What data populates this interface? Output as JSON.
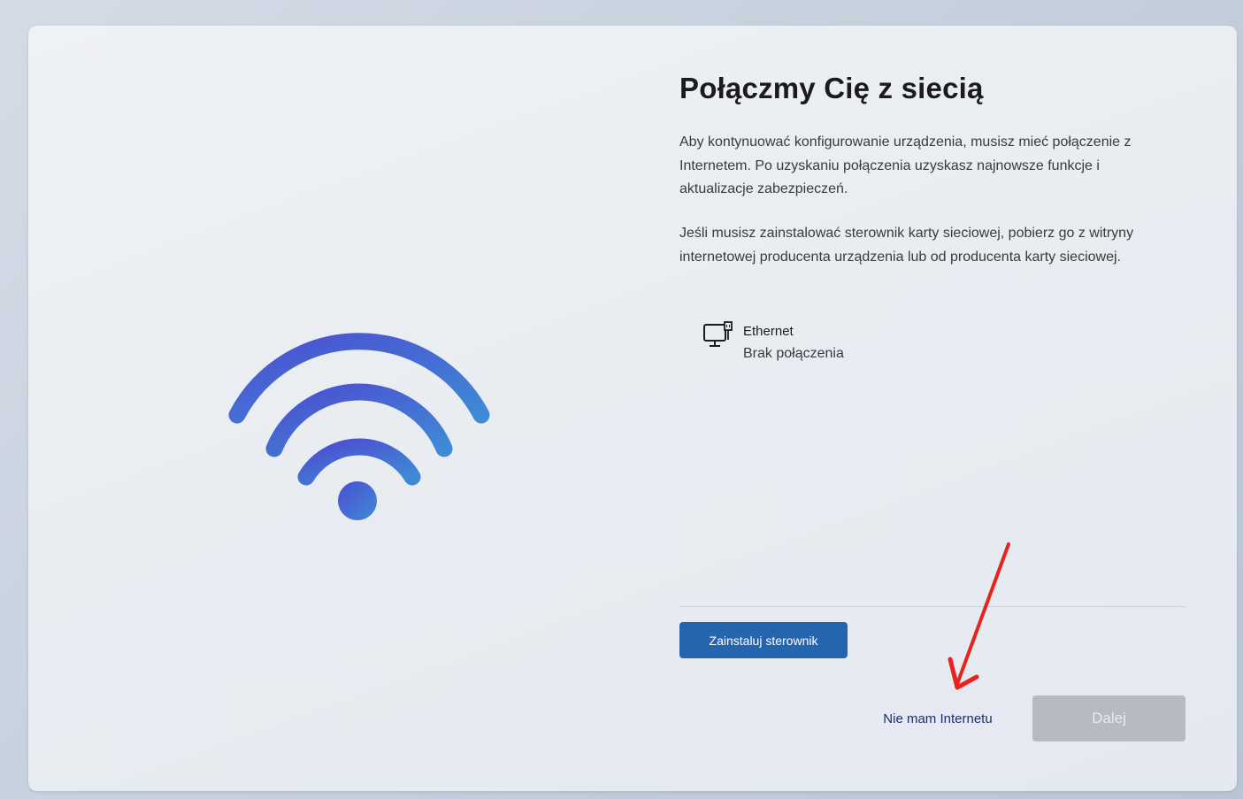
{
  "page": {
    "title": "Połączmy Cię z siecią",
    "paragraphs": [
      "Aby kontynuować konfigurowanie urządzenia, musisz mieć połączenie z Internetem. Po uzyskaniu połączenia uzyskasz najnowsze funkcje i aktualizacje zabezpieczeń.",
      "Jeśli musisz zainstalować sterownik karty sieciowej, pobierz go z witryny internetowej producenta urządzenia lub od producenta karty sieciowej."
    ]
  },
  "network": {
    "icon": "ethernet-icon",
    "name": "Ethernet",
    "status": "Brak połączenia"
  },
  "buttons": {
    "install_driver": "Zainstaluj sterownik",
    "no_internet": "Nie mam Internetu",
    "next": "Dalej"
  },
  "illustration": {
    "icon": "wifi-icon"
  },
  "annotation": {
    "icon": "red-arrow-icon",
    "color": "#e8231e"
  },
  "colors": {
    "accent": "#2565ae",
    "disabled_button": "#b6bac1",
    "wifi_gradient_start": "#4b4fd1",
    "wifi_gradient_end": "#3f8ad6"
  }
}
